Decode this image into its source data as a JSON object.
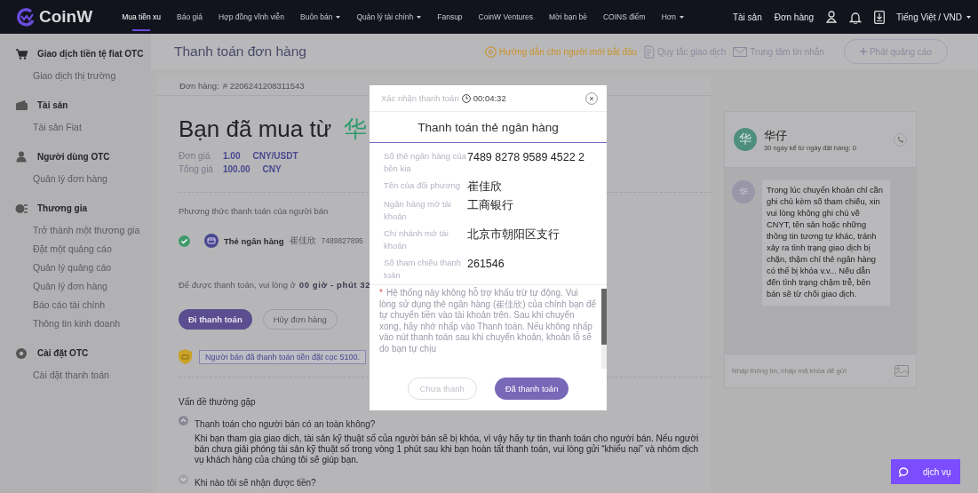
{
  "nav": {
    "logo": "CoinW",
    "items": [
      {
        "label": "Mua tiền xu",
        "selected": true,
        "dropdown": false
      },
      {
        "label": "Báo giá",
        "selected": false,
        "dropdown": false
      },
      {
        "label": "Hợp đồng vĩnh viễn",
        "selected": false,
        "dropdown": false
      },
      {
        "label": "Buôn bán",
        "selected": false,
        "dropdown": true
      },
      {
        "label": "Quản lý tài chính",
        "selected": false,
        "dropdown": true
      },
      {
        "label": "Fansup",
        "selected": false,
        "dropdown": false
      },
      {
        "label": "CoinW Ventures",
        "selected": false,
        "dropdown": false
      },
      {
        "label": "Mời bạn bè",
        "selected": false,
        "dropdown": false
      },
      {
        "label": "COINS điểm",
        "selected": false,
        "dropdown": false
      },
      {
        "label": "Hơn",
        "selected": false,
        "dropdown": true
      }
    ],
    "right_links": [
      "Tài sản",
      "Đơn hàng"
    ],
    "language": "Tiếng Việt / VND"
  },
  "sidebar": {
    "sections": [
      {
        "title": "Giao dịch tiền tệ fiat OTC",
        "children": [
          {
            "label": "Giao dịch thị trường"
          }
        ]
      },
      {
        "title": "Tài sản",
        "children": [
          {
            "label": "Tài sản Fiat"
          }
        ]
      },
      {
        "title": "Người dùng OTC",
        "children": [
          {
            "label": "Quản lý đơn hàng"
          }
        ]
      },
      {
        "title": "Thương gia",
        "children": [
          {
            "label": "Trở thành một thương gia"
          },
          {
            "label": "Đặt một quảng cáo"
          },
          {
            "label": "Quản lý quảng cáo"
          },
          {
            "label": "Quản lý đơn hàng"
          },
          {
            "label": "Báo cáo tài chính"
          },
          {
            "label": "Thông tin kinh doanh"
          }
        ]
      },
      {
        "title": "Cài đặt OTC",
        "children": [
          {
            "label": "Cài đặt thanh toán"
          }
        ]
      }
    ]
  },
  "page_header": {
    "title": "Thanh toán đơn hàng",
    "links": [
      {
        "kind": "guide",
        "label": "Hướng dẫn cho người mới bắt đầu"
      },
      {
        "kind": "normal",
        "label": "Quy tắc giao dịch"
      },
      {
        "kind": "normal",
        "label": "Trung tâm tin nhắn"
      }
    ],
    "post_button": "Phát quảng cáo"
  },
  "order": {
    "number_label": "Đơn hàng:",
    "number": "# 2206241208311543",
    "heading": "Bạn đã mua từ",
    "seller": "华",
    "prices": [
      {
        "label": "Đơn giá",
        "value": "1.00",
        "unit": "CNY/USDT"
      },
      {
        "label": "Tổng giá",
        "value": "100.00",
        "unit": "CNY"
      }
    ],
    "methods_label": "Phương thức thanh toán của người bán",
    "method": {
      "checked": true,
      "name": "Thẻ ngân hàng",
      "holder": "崔佳欣",
      "account": "7489827895"
    },
    "countdown_label": "Để được thanh toán, vui lòng ở",
    "countdown": "00 giờ - phút 32",
    "buttons": [
      {
        "label": "Đi thanh toán",
        "kind": "primary"
      },
      {
        "label": "Hủy đơn hàng",
        "kind": "outline"
      }
    ],
    "deposit": "Người bán đã thanh toán tiền đặt cọc 5100."
  },
  "faq": {
    "title": "Vấn đề thường gặp",
    "items": [
      {
        "question": "Thanh toán cho người bán có an toàn không?",
        "expanded": true,
        "answer": "Khi bạn tham gia giao dịch, tài sản kỹ thuật số của người bán sẽ bị khóa, vì vậy hãy tự tin thanh toán cho người bán. Nếu người bán chưa giải phóng tài sản kỹ thuật số trong vòng 1 phút sau khi bạn hoàn tất thanh toán, vui lòng gửi “khiếu nại” và nhóm dịch vụ khách hàng của chúng tôi sẽ giúp bạn."
      },
      {
        "question": "Khi nào tôi sẽ nhận được tiền?",
        "expanded": false
      }
    ]
  },
  "chat": {
    "avatar": "华",
    "name": "华仔",
    "stats": "30 ngày kể từ ngày đặt hàng: 0",
    "messages": [
      {
        "avatar": "华",
        "text": "Trong lúc chuyển khoản chỉ cần ghi chú kèm số tham chiếu, xin vui lòng không ghi chú về CNYT, tên sản hoặc những thông tin tương tự khác, tránh xảy ra tình trạng giao dịch bị chặn, thậm chí thẻ ngân hàng có thể bị khóa v.v... Nếu dẫn đến tình trạng chậm trễ, bên bán sẽ từ chối giao dịch."
      }
    ],
    "input_placeholder": "Nhập thông tin, nhập mã khóa để gửi"
  },
  "service_button": "dịch vụ",
  "modal": {
    "title": "Xác nhận thanh toán",
    "timer": "00:04:32",
    "heading": "Thanh toán thẻ ngân hàng",
    "fields": [
      {
        "label": "Số thẻ ngân hàng của bên kia",
        "value": "7489 8278 9589 4522 2"
      },
      {
        "label": "Tên của đối phương",
        "value": "崔佳欣"
      },
      {
        "label": "Ngân hàng mở tài khoản",
        "value": "工商银行"
      },
      {
        "label": "Chi nhánh mở tài khoản",
        "value": "北京市朝阳区支行"
      },
      {
        "label": "Số tham chiếu thanh toán",
        "value": "261546"
      }
    ],
    "note_mark": "*",
    "note": "Hệ thống này không hỗ trợ khấu trừ tự động. Vui lòng sử dụng thẻ ngân hàng (崔佳欣) của chính bạn để tự chuyển tiền vào tài khoản trên. Sau khi chuyển xong, hãy nhớ nhấp vào Thanh toán. Nếu không nhấp vào nút thanh toán sau khi chuyển khoản, khoản lỗ sẽ do bạn tự chịu",
    "buttons": [
      {
        "label": "Chưa thanh",
        "kind": "outline"
      },
      {
        "label": "Đã thanh toán",
        "kind": "primary"
      }
    ]
  }
}
